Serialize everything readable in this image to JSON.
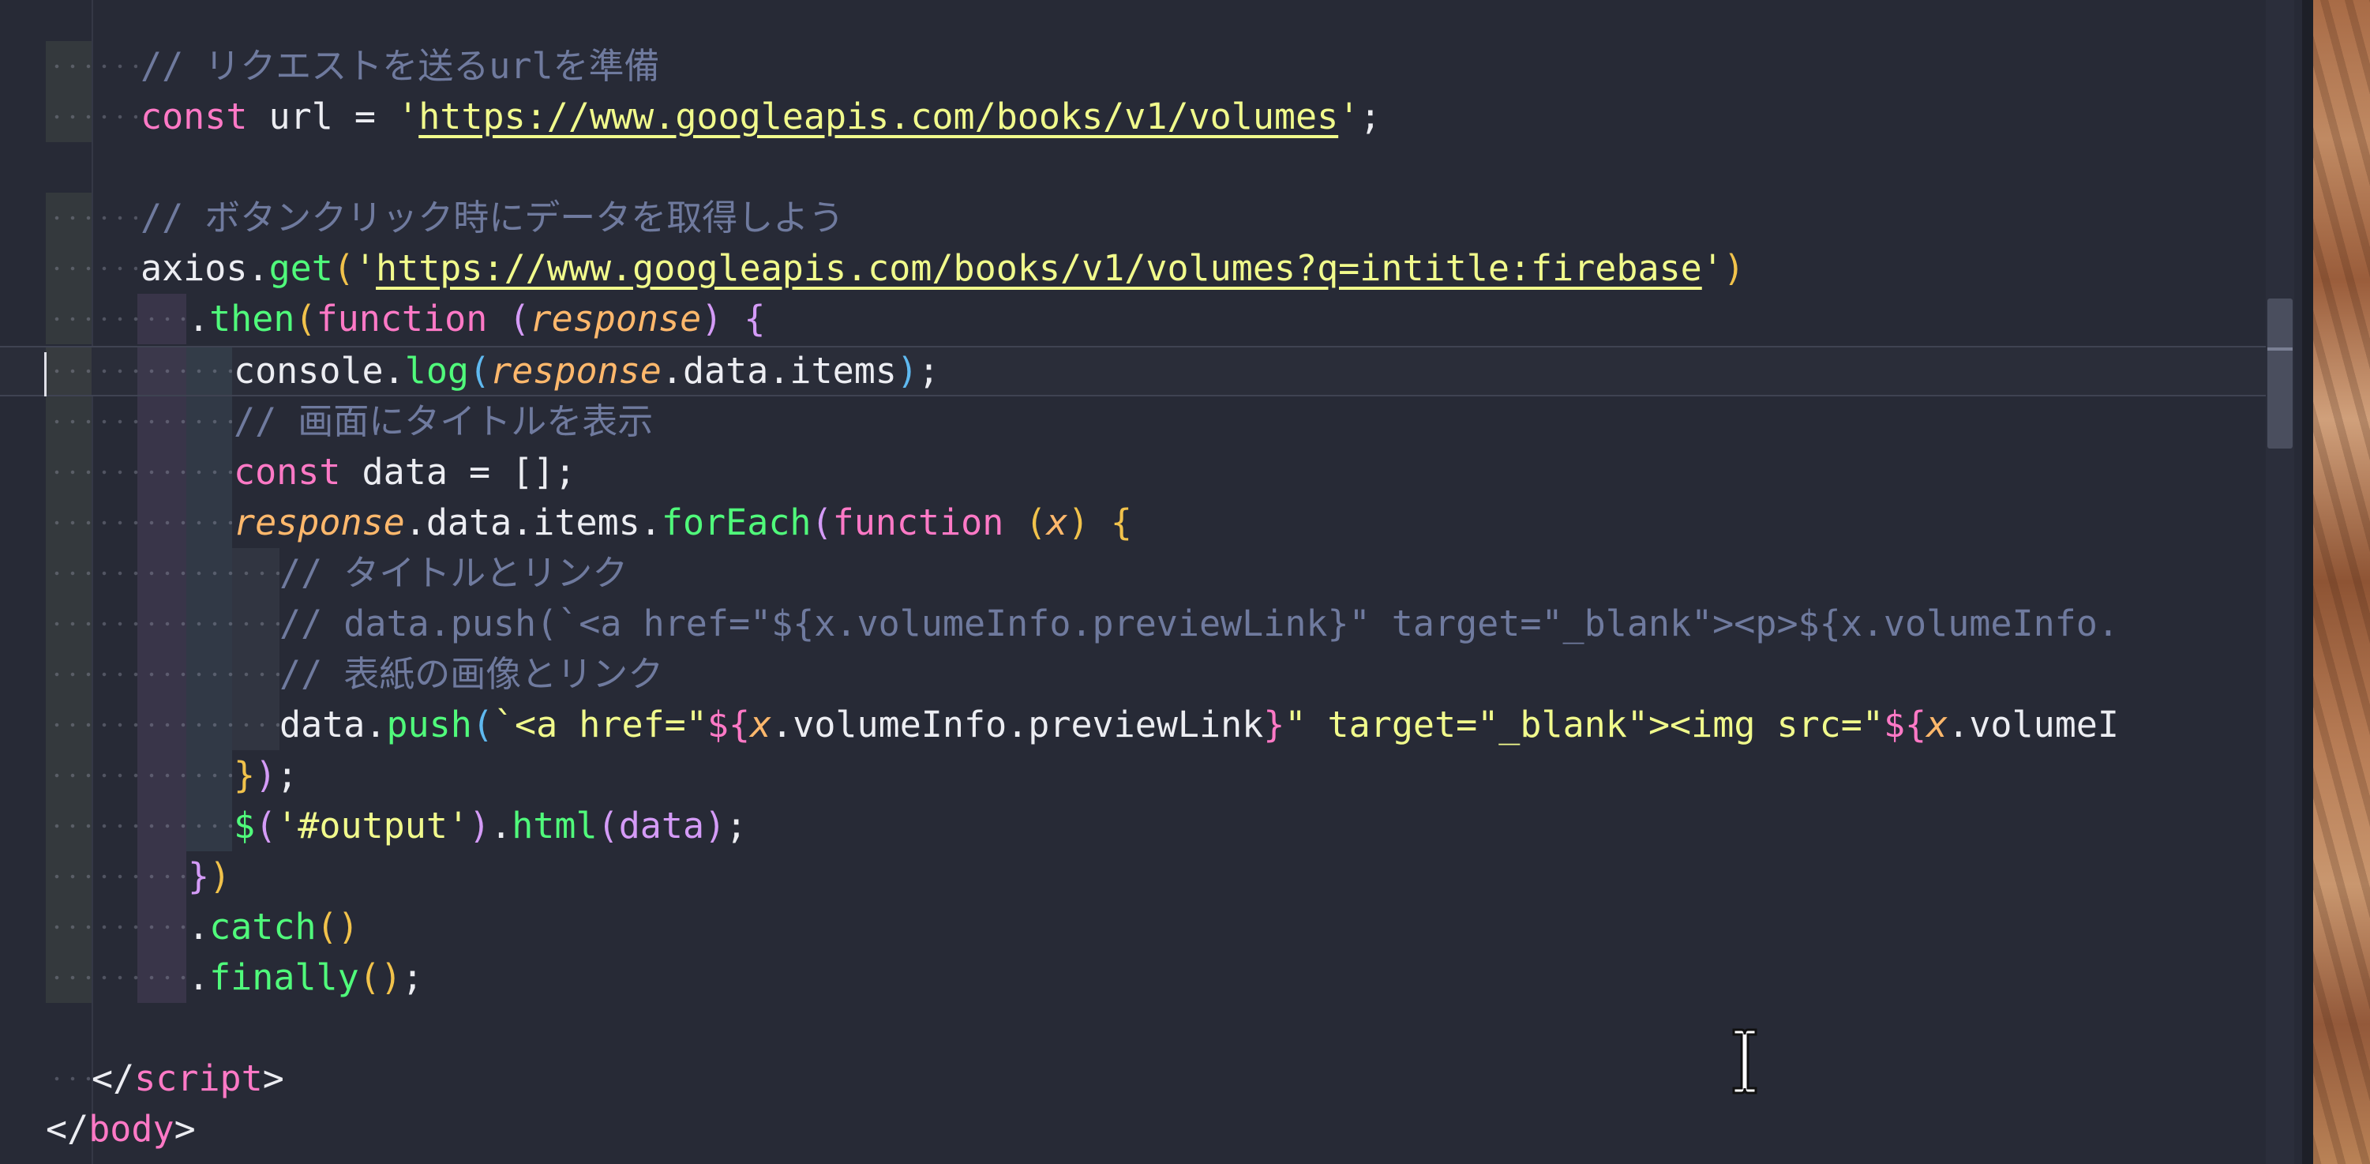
{
  "editor": {
    "language": "javascript/html",
    "theme": "dark",
    "colors": {
      "background": "#272a36",
      "comment": "#6f7a9e",
      "keyword": "#ff79c6",
      "function": "#50fa7b",
      "string": "#f1fa8c",
      "parameter": "#ffb86c",
      "text": "#ecedf2"
    }
  },
  "lines": {
    "l1": {
      "cmt": "// リクエストを送るurlを準備"
    },
    "l2": {
      "kw": "const",
      "name": " url = ",
      "q1": "'",
      "url": "https://www.googleapis.com/books/v1/volumes",
      "q2": "'",
      "end": ";"
    },
    "l4": {
      "cmt": "// ボタンクリック時にデータを取得しよう"
    },
    "l5": {
      "obj": "axios.",
      "fn": "get",
      "open": "(",
      "q1": "'",
      "url": "https://www.googleapis.com/books/v1/volumes?q=intitle:firebase",
      "q2": "'",
      "close": ")"
    },
    "l6": {
      "dot": ".",
      "fn": "then",
      "open": "(",
      "kw": "function",
      "sp": " ",
      "popen": "(",
      "param": "response",
      "pclose": ")",
      "brace": " {"
    },
    "l7": {
      "obj": "console.",
      "fn": "log",
      "open": "(",
      "param": "response",
      "rest": ".data.items",
      "close": ")",
      "end": ";"
    },
    "l8": {
      "cmt": "// 画面にタイトルを表示"
    },
    "l9": {
      "kw": "const",
      "name": " data = ",
      "arr": "[]",
      "end": ";"
    },
    "l10": {
      "param": "response",
      "rest": ".data.items.",
      "fn": "forEach",
      "open": "(",
      "kw": "function",
      "sp": " ",
      "popen": "(",
      "param2": "x",
      "pclose": ")",
      "brace": " {"
    },
    "l11": {
      "cmt": "// タイトルとリンク"
    },
    "l12": {
      "cmt": "// data.push(`<a href=\"${x.volumeInfo.previewLink}\" target=\"_blank\"><p>${x.volumeInfo."
    },
    "l13": {
      "cmt": "// 表紙の画像とリンク"
    },
    "l14": {
      "obj": "data.",
      "fn": "push",
      "open": "(",
      "tpl1": "`<a href=\"",
      "d1": "${",
      "x1": "x",
      "mid1": ".volumeInfo.previewLink",
      "c1": "}",
      "tpl2": "\" target=\"_blank\"><img src=\"",
      "d2": "${",
      "x2": "x",
      "mid2": ".volumeI"
    },
    "l15": {
      "brace": "}",
      "close": ")",
      "end": ";"
    },
    "l16": {
      "fn": "$",
      "open": "(",
      "str": "'#output'",
      "close": ")",
      "dot": ".",
      "fn2": "html",
      "open2": "(",
      "arg": "data",
      "close2": ")",
      "end": ";"
    },
    "l17": {
      "brace": "}",
      "close": ")"
    },
    "l18": {
      "dot": ".",
      "fn": "catch",
      "parens": "()"
    },
    "l19": {
      "dot": ".",
      "fn": "finally",
      "parens": "()",
      "end": ";"
    },
    "l21": {
      "open": "</",
      "tag": "script",
      "close": ">"
    },
    "l22": {
      "open": "</",
      "tag": "body",
      "close": ">"
    }
  }
}
